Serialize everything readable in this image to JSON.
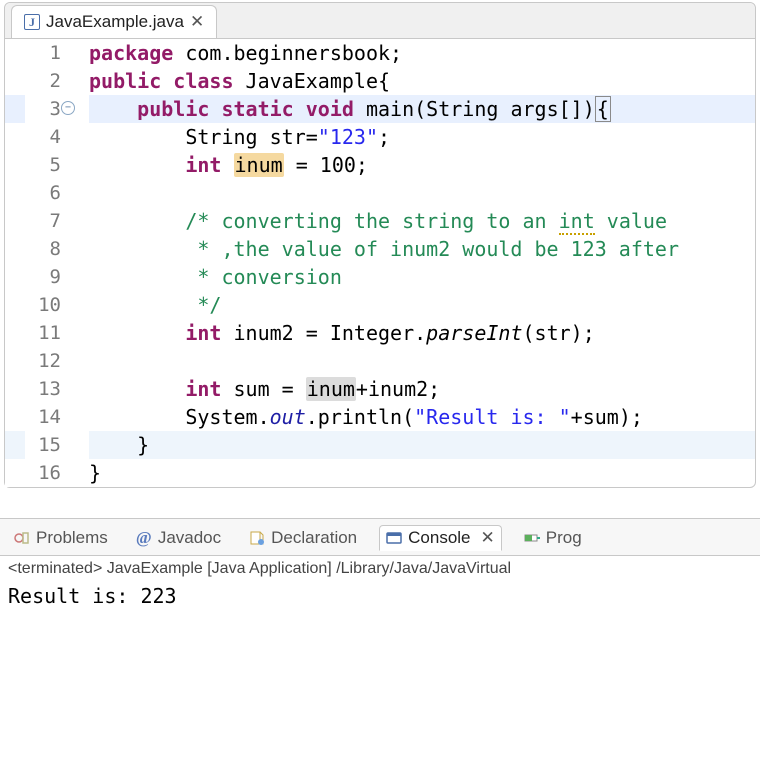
{
  "editor": {
    "tab": {
      "filename": "JavaExample.java"
    },
    "lines": [
      {
        "n": 1,
        "indent": "",
        "tokens": [
          [
            "kw",
            "package"
          ],
          [
            "",
            " com.beginnersbook;"
          ]
        ]
      },
      {
        "n": 2,
        "indent": "",
        "tokens": [
          [
            "kw",
            "public"
          ],
          [
            "",
            " "
          ],
          [
            "kw",
            "class"
          ],
          [
            "",
            " JavaExample{"
          ]
        ]
      },
      {
        "n": 3,
        "indent": "\t",
        "fold": true,
        "hl": "hl-line",
        "tokens": [
          [
            "kw",
            "public"
          ],
          [
            "",
            " "
          ],
          [
            "kw",
            "static"
          ],
          [
            "",
            " "
          ],
          [
            "kw",
            "void"
          ],
          [
            "",
            " main(String args[])"
          ],
          [
            "bracket-box",
            "{"
          ]
        ]
      },
      {
        "n": 4,
        "indent": "\t\t",
        "tokens": [
          [
            "",
            "String str="
          ],
          [
            "str",
            "\"123\""
          ],
          [
            "",
            ";"
          ]
        ]
      },
      {
        "n": 5,
        "indent": "\t\t",
        "tokens": [
          [
            "kw",
            "int"
          ],
          [
            "",
            " "
          ],
          [
            "hlword",
            "inum"
          ],
          [
            "",
            " = 100;"
          ]
        ]
      },
      {
        "n": 6,
        "indent": "\t\t",
        "tokens": []
      },
      {
        "n": 7,
        "indent": "\t\t",
        "tokens": [
          [
            "cmt",
            "/* converting the string to an "
          ],
          [
            "cmt underline-warn",
            "int"
          ],
          [
            "cmt",
            " value"
          ]
        ]
      },
      {
        "n": 8,
        "indent": "\t\t",
        "tokens": [
          [
            "cmt",
            " * ,the value of inum2 would be 123 after"
          ]
        ]
      },
      {
        "n": 9,
        "indent": "\t\t",
        "tokens": [
          [
            "cmt",
            " * conversion"
          ]
        ]
      },
      {
        "n": 10,
        "indent": "\t\t",
        "tokens": [
          [
            "cmt",
            " */"
          ]
        ]
      },
      {
        "n": 11,
        "indent": "\t\t",
        "tokens": [
          [
            "kw",
            "int"
          ],
          [
            "",
            " inum2 = Integer."
          ],
          [
            "methitalic",
            "parseInt"
          ],
          [
            "",
            "(str);"
          ]
        ]
      },
      {
        "n": 12,
        "indent": "\t\t",
        "tokens": []
      },
      {
        "n": 13,
        "indent": "\t\t",
        "tokens": [
          [
            "kw",
            "int"
          ],
          [
            "",
            " sum = "
          ],
          [
            "hlword2",
            "inum"
          ],
          [
            "",
            "+inum2;"
          ]
        ]
      },
      {
        "n": 14,
        "indent": "\t\t",
        "tokens": [
          [
            "",
            "System."
          ],
          [
            "static-it",
            "out"
          ],
          [
            "",
            ".println("
          ],
          [
            "str",
            "\"Result is: \""
          ],
          [
            "",
            "+sum);"
          ]
        ]
      },
      {
        "n": 15,
        "indent": "\t",
        "hl": "hl-line-alt",
        "tokens": [
          [
            "",
            "}"
          ]
        ]
      },
      {
        "n": 16,
        "indent": "",
        "tokens": [
          [
            "",
            "}"
          ]
        ]
      }
    ]
  },
  "views": {
    "problems": "Problems",
    "javadoc": "Javadoc",
    "declaration": "Declaration",
    "console": "Console",
    "progress": "Prog"
  },
  "console": {
    "status": "<terminated> JavaExample [Java Application] /Library/Java/JavaVirtual",
    "output": "Result is: 223"
  }
}
